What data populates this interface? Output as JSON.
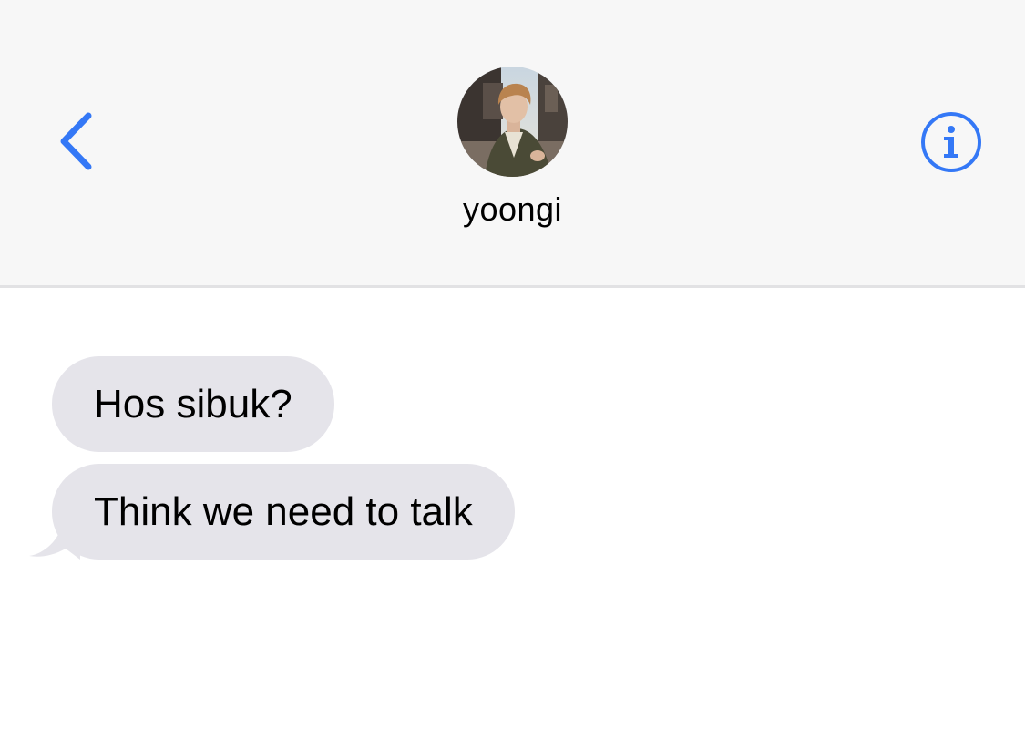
{
  "header": {
    "contact_name": "yoongi",
    "back_icon": "chevron-left-icon",
    "info_icon": "info-icon",
    "accent_color": "#3478f6",
    "background_color": "#f7f7f7"
  },
  "messages": [
    {
      "sender": "incoming",
      "text": "Hos sibuk?"
    },
    {
      "sender": "incoming",
      "text": "Think we need to talk"
    }
  ],
  "colors": {
    "incoming_bubble": "#e5e4ea",
    "text": "#000000"
  }
}
